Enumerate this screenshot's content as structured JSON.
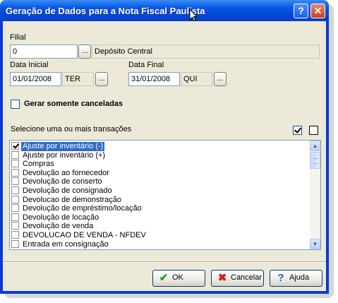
{
  "window": {
    "title": "Geração de Dados para a Nota Fiscal Paulista",
    "help_label": "?",
    "close_label": "✕"
  },
  "filial": {
    "label": "Filial",
    "value": "0",
    "lookup_label": "...",
    "description": "Depósito Central"
  },
  "data_inicial": {
    "label": "Data Inicial",
    "value": "01/01/2008",
    "weekday": "TER",
    "lookup_label": "..."
  },
  "data_final": {
    "label": "Data Final",
    "value": "31/01/2008",
    "weekday": "QUI",
    "lookup_label": "..."
  },
  "gerar_canceladas": {
    "label": "Gerar somente canceladas",
    "checked": false
  },
  "transacoes": {
    "label": "Selecione uma ou mais transações",
    "select_all_checked": true,
    "select_none_checked": false,
    "items": [
      {
        "label": "Ajuste por inventário (-)",
        "checked": true,
        "selected": true
      },
      {
        "label": "Ajuste por inventário (+)",
        "checked": false,
        "selected": false
      },
      {
        "label": "Compras",
        "checked": false,
        "selected": false
      },
      {
        "label": "Devolução ao fornecedor",
        "checked": false,
        "selected": false
      },
      {
        "label": "Devolução de conserto",
        "checked": false,
        "selected": false
      },
      {
        "label": "Devolução de consignado",
        "checked": false,
        "selected": false
      },
      {
        "label": "Devolucao de demonstração",
        "checked": false,
        "selected": false
      },
      {
        "label": "Devolução de empréstimo/locação",
        "checked": false,
        "selected": false
      },
      {
        "label": "Devolução de locação",
        "checked": false,
        "selected": false
      },
      {
        "label": "Devolução de venda",
        "checked": false,
        "selected": false
      },
      {
        "label": "DEVOLUCAO DE VENDA - NFDEV",
        "checked": false,
        "selected": false
      },
      {
        "label": "Entrada em consignação",
        "checked": false,
        "selected": false
      }
    ]
  },
  "buttons": {
    "ok": "OK",
    "cancelar": "Cancelar",
    "ajuda": "Ajuda"
  },
  "colors": {
    "title_bar": "#0a58e6",
    "dialog_bg": "#ece9d8",
    "selection": "#316ac5",
    "ok_icon": "#21a121",
    "cancel_icon": "#c9271b",
    "help_icon": "#2a63d6"
  }
}
